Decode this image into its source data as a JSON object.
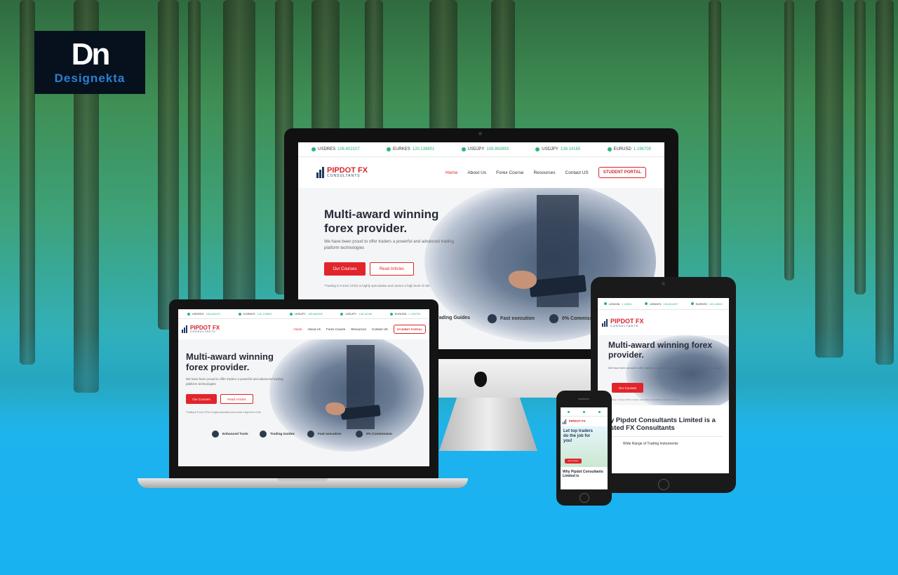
{
  "logo": {
    "mark": "Dn",
    "text": "Designekta"
  },
  "site": {
    "ticker": [
      {
        "pair": "USDRES",
        "value": "106.602107"
      },
      {
        "pair": "EURKES",
        "value": "120.139801"
      },
      {
        "pair": "USDJPY",
        "value": "108.863993"
      },
      {
        "pair": "USDJPY",
        "value": "138.14165"
      },
      {
        "pair": "EURUSD",
        "value": "1.196709"
      }
    ],
    "brand": {
      "name": "PIPDOT FX",
      "sub": "CONSULTANTS"
    },
    "nav": [
      "Home",
      "About Us",
      "Forex Course",
      "Resources",
      "Contact US"
    ],
    "portal": "STUDENT PORTAL",
    "hero": {
      "title_line1": "Multi-award winning",
      "title_line2": "forex provider.",
      "title_full": "Multi-award winning forex provider.",
      "text": "We have been proud to offer traders a powerful and advanced trading platform technologies",
      "btn_primary": "Our Courses",
      "btn_secondary": "Read Articles",
      "note": "*Trading in Forex/ CFDs is highly speculative and carries a high level of risk."
    },
    "features": [
      "Enhanced Tools",
      "Trading Guides",
      "Fast execution",
      "0% Commission"
    ],
    "features_monitor": [
      "rading Guides",
      "Fast execution",
      "0% Commissi"
    ],
    "tablet": {
      "ticker": [
        {
          "pair": "USDCNI",
          "value": "1.19501"
        },
        {
          "pair": "USDKES",
          "value": "106.801007"
        },
        {
          "pair": "EURKES",
          "value": "120.19801"
        }
      ],
      "why": "y Pipdot Consultants Limited is a",
      "why2": "sted FX Consultants",
      "wide": "Wide Range of Trading Instruments"
    },
    "phone": {
      "hero": "Let top traders do the job for you!",
      "btn": "Our Courses",
      "why": "Why Pipdot Consultants Limited is"
    }
  }
}
